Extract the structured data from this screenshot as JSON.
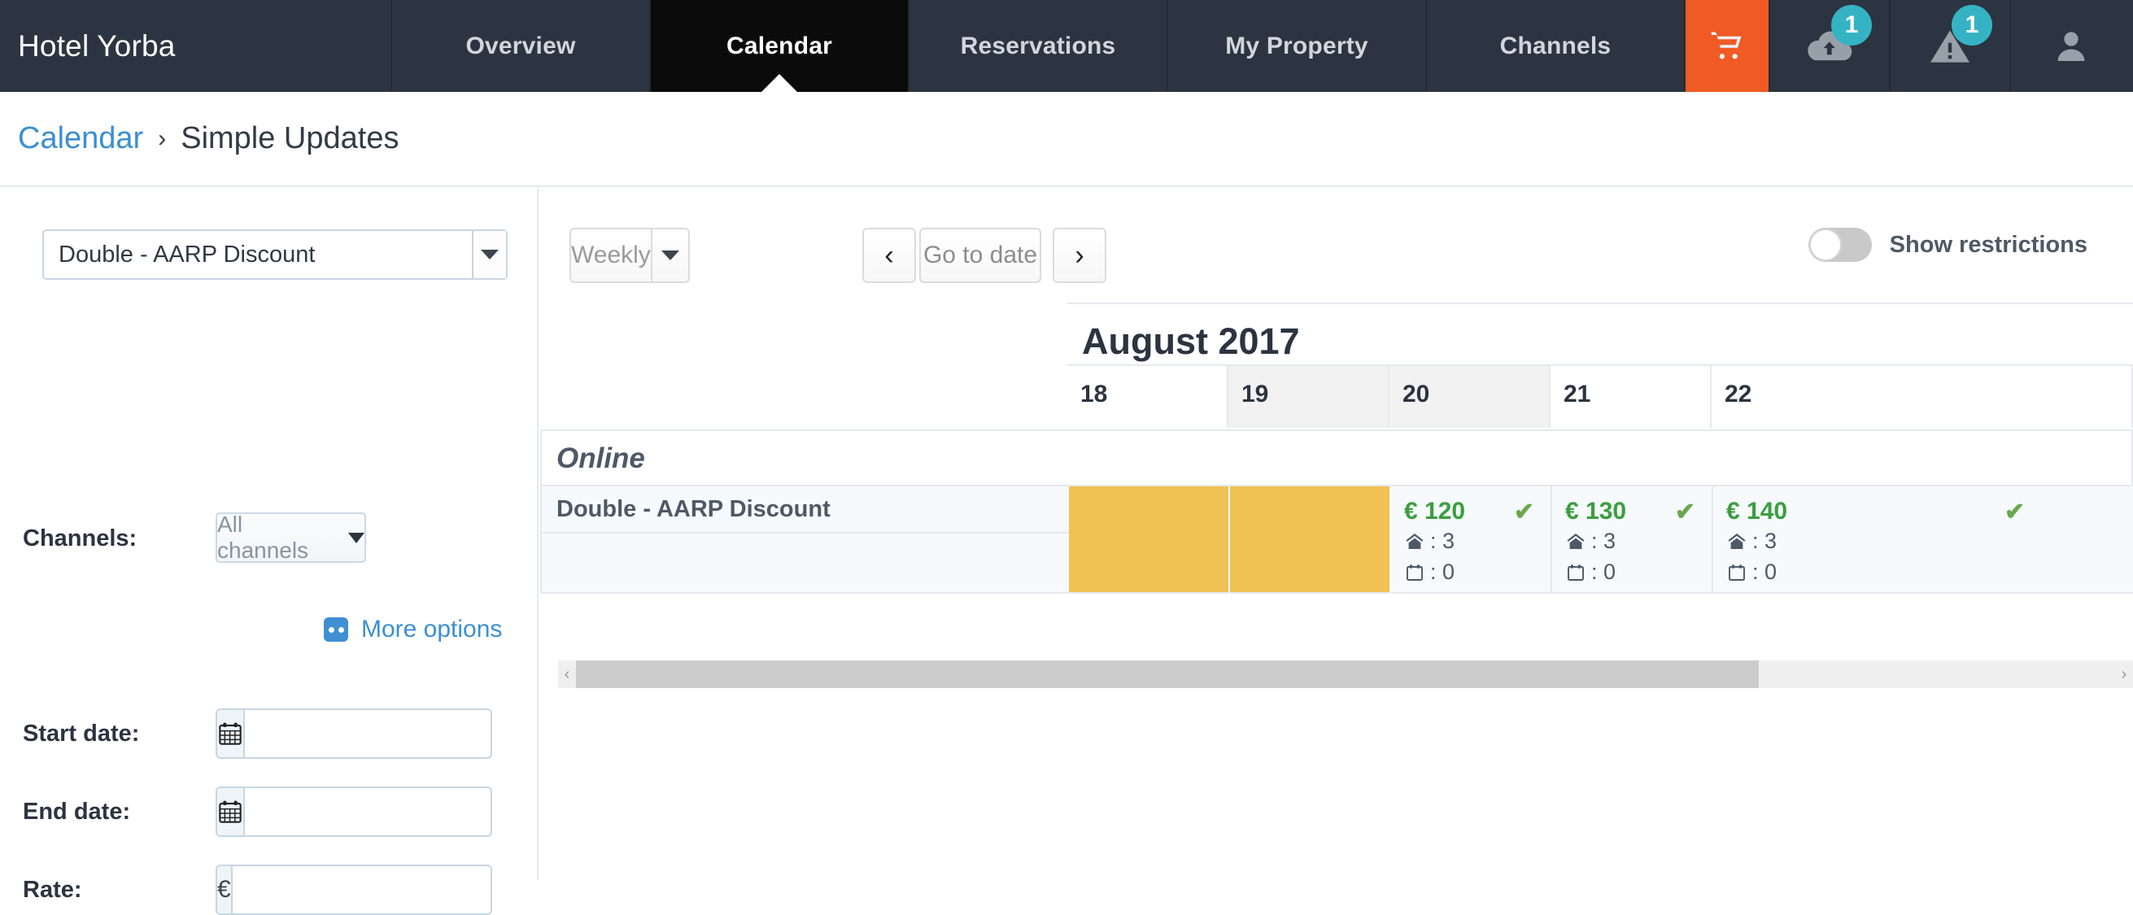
{
  "topnav": {
    "brand": "Hotel Yorba",
    "tabs": [
      {
        "label": "Overview",
        "active": false
      },
      {
        "label": "Calendar",
        "active": true
      },
      {
        "label": "Reservations",
        "active": false
      },
      {
        "label": "My Property",
        "active": false
      },
      {
        "label": "Channels",
        "active": false
      }
    ],
    "icons": [
      {
        "name": "cart-icon",
        "badge": ""
      },
      {
        "name": "cloud-upload-icon",
        "badge": "1"
      },
      {
        "name": "warning-icon",
        "badge": "1"
      },
      {
        "name": "user-icon",
        "badge": ""
      }
    ],
    "accent_orange": "#f05a24",
    "badge_color": "#35b3c4"
  },
  "breadcrumb": {
    "parent": "Calendar",
    "separator": "›",
    "current": "Simple Updates"
  },
  "sidebar": {
    "rate_select": {
      "value": "Double - AARP Discount"
    },
    "channels": {
      "label": "Channels:",
      "value": "All channels"
    },
    "more_options": {
      "label": "More options"
    },
    "start_date": {
      "label": "Start date:",
      "value": "",
      "placeholder": ""
    },
    "end_date": {
      "label": "End date:",
      "value": "",
      "placeholder": ""
    },
    "rate": {
      "label": "Rate:",
      "value": "",
      "placeholder": "",
      "currency": "€"
    }
  },
  "toolbar": {
    "view": "Weekly",
    "prev": "‹",
    "goto": "Go to date",
    "next": "›",
    "show_restrictions": "Show restrictions",
    "restrictions_on": false
  },
  "calendar": {
    "month": "August 2017",
    "days": [
      {
        "num": "18",
        "weekend": false
      },
      {
        "num": "19",
        "weekend": true
      },
      {
        "num": "20",
        "weekend": true
      },
      {
        "num": "21",
        "weekend": false
      },
      {
        "num": "22",
        "weekend": false
      }
    ],
    "group_label": "Online",
    "rate_row_label": "Double - AARP Discount",
    "cells": [
      {
        "blocked": true,
        "price": "",
        "check": "",
        "rooms": "",
        "minstay": ""
      },
      {
        "blocked": true,
        "price": "",
        "check": "",
        "rooms": "",
        "minstay": ""
      },
      {
        "blocked": false,
        "price": "€ 120",
        "check": "✔",
        "rooms": ": 3",
        "minstay": ": 0"
      },
      {
        "blocked": false,
        "price": "€ 130",
        "check": "✔",
        "rooms": ": 3",
        "minstay": ": 0"
      },
      {
        "blocked": false,
        "price": "€ 140",
        "check": "✔",
        "rooms": ": 3",
        "minstay": ": 0"
      }
    ],
    "blocked_color": "#f0c153",
    "price_color": "#3a9e3f"
  },
  "scrollbar": {
    "left_arrow": "‹",
    "right_arrow": "›"
  }
}
